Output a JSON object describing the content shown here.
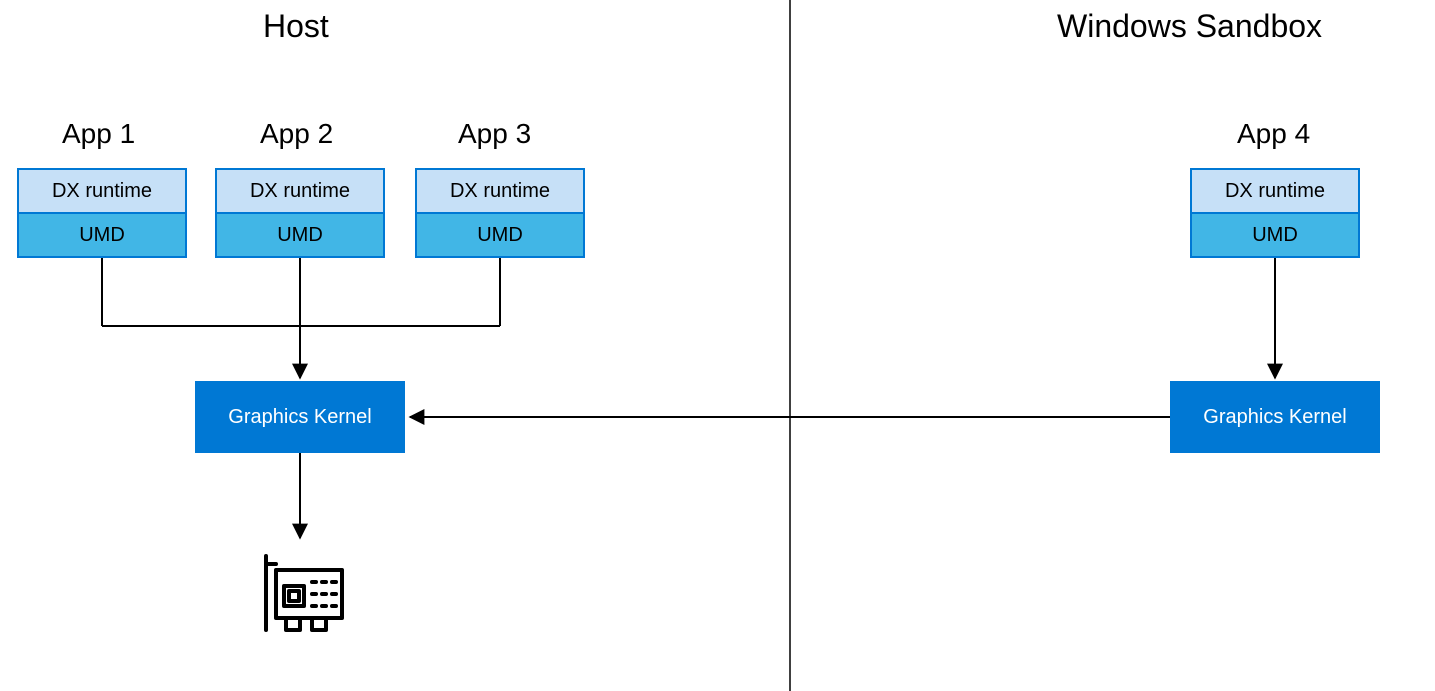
{
  "titles": {
    "host": "Host",
    "sandbox": "Windows Sandbox"
  },
  "apps": {
    "a1": "App 1",
    "a2": "App 2",
    "a3": "App 3",
    "a4": "App 4"
  },
  "labels": {
    "dx": "DX runtime",
    "umd": "UMD",
    "kernel": "Graphics Kernel"
  },
  "colors": {
    "border": "#0078d4",
    "dx_bg": "#c6e0f7",
    "umd_bg": "#41b6e6",
    "kernel_bg": "#0078d4",
    "kernel_fg": "#ffffff"
  }
}
